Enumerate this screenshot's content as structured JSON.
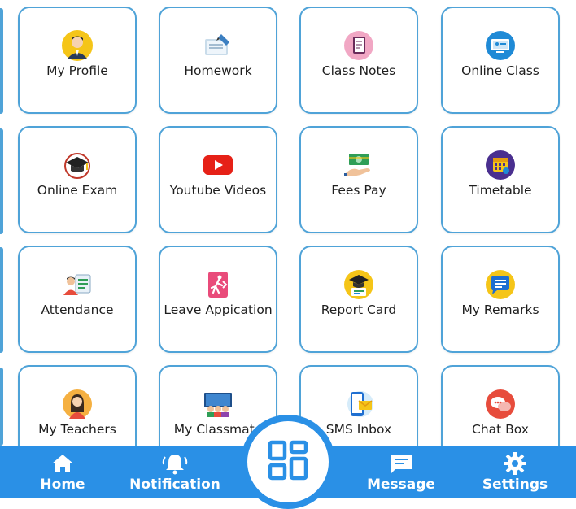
{
  "tiles": [
    {
      "label": "My Profile",
      "icon": "profile-avatar-icon"
    },
    {
      "label": "Homework",
      "icon": "homework-icon"
    },
    {
      "label": "Class Notes",
      "icon": "notebook-icon"
    },
    {
      "label": "Online Class",
      "icon": "online-class-icon"
    },
    {
      "label": "Online Exam",
      "icon": "graduation-cap-icon"
    },
    {
      "label": "Youtube Videos",
      "icon": "youtube-play-icon"
    },
    {
      "label": "Fees Pay",
      "icon": "money-hand-icon"
    },
    {
      "label": "Timetable",
      "icon": "calendar-icon"
    },
    {
      "label": "Attendance",
      "icon": "attendance-icon"
    },
    {
      "label": "Leave Appication",
      "icon": "exit-door-icon"
    },
    {
      "label": "Report Card",
      "icon": "report-card-icon"
    },
    {
      "label": "My Remarks",
      "icon": "chat-bubble-icon"
    },
    {
      "label": "My Teachers",
      "icon": "teacher-avatar-icon"
    },
    {
      "label": "My Classmate",
      "icon": "classmates-icon"
    },
    {
      "label": "SMS Inbox",
      "icon": "sms-inbox-icon"
    },
    {
      "label": "Chat Box",
      "icon": "chat-box-icon"
    }
  ],
  "nav": {
    "home": "Home",
    "notification": "Notification",
    "message": "Message",
    "settings": "Settings"
  },
  "colors": {
    "accent": "#2a90e6",
    "tile_border": "#4fa3d8"
  }
}
